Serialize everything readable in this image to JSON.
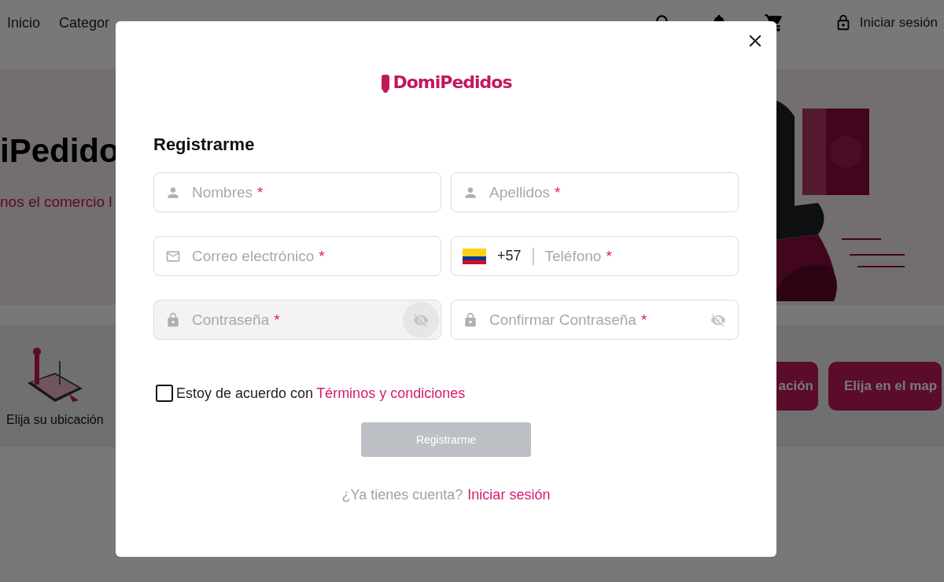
{
  "nav": {
    "links": [
      "Inicio",
      "Categor"
    ],
    "login": "Iniciar sesión"
  },
  "hero": {
    "title": "iPedido",
    "subtitle": "nos el comercio l"
  },
  "strip": {
    "location_label": "Elija su ubicación",
    "buttons": [
      "ación",
      "Elija en el map"
    ]
  },
  "modal": {
    "logo": "DomiPedidos",
    "title": "Registrarme",
    "fields": [
      {
        "kind": "person",
        "placeholder": "Nombres",
        "mark": "*",
        "hovered": false
      },
      {
        "kind": "person",
        "placeholder": "Apellidos",
        "mark": "*",
        "hovered": false
      },
      {
        "kind": "email",
        "placeholder": "Correo electrónico",
        "mark": "*",
        "hovered": false
      },
      {
        "kind": "phone",
        "country_code": "+57",
        "placeholder": "Teléfono",
        "mark": "*",
        "hovered": false
      },
      {
        "kind": "password",
        "placeholder": "Contraseña",
        "mark": "*",
        "hovered": true
      },
      {
        "kind": "password",
        "placeholder": "Confirmar Contraseña",
        "mark": "*",
        "hovered": false
      }
    ],
    "agreement": {
      "checked": false,
      "text": "Estoy de acuerdo con",
      "link": "Términos y condiciones"
    },
    "submit": {
      "label": "Registrarme",
      "disabled": true
    },
    "footer": {
      "text": "¿Ya tienes cuenta?",
      "link": "Iniciar sesión"
    }
  }
}
